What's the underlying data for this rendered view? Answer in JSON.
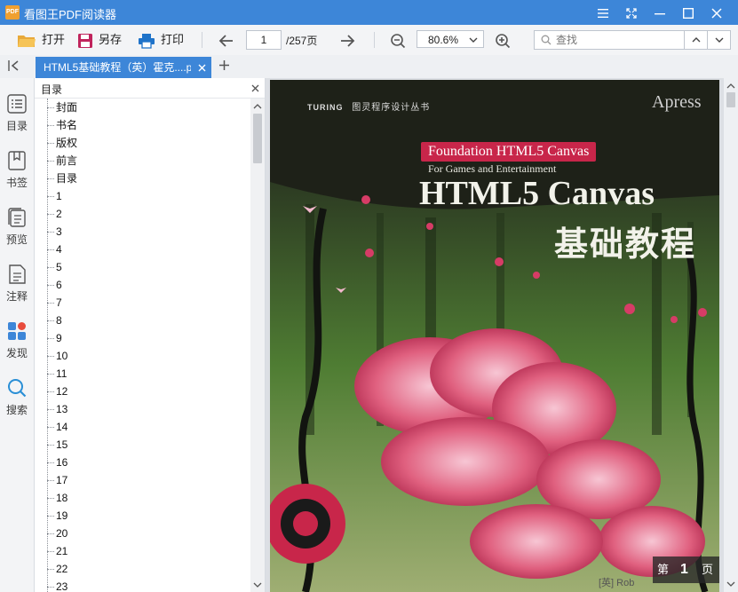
{
  "app": {
    "logo_text": "PDF",
    "title": "看图王PDF阅读器"
  },
  "toolbar": {
    "open_label": "打开",
    "save_as_label": "另存",
    "print_label": "打印",
    "current_page": "1",
    "total_pages": "/257页",
    "zoom_value": "80.6%",
    "search_placeholder": "查找"
  },
  "tabs": [
    {
      "label": "HTML5基础教程（英）霍克....p",
      "active": true
    }
  ],
  "left_rail": [
    {
      "label": "目录",
      "icon": "outline-icon"
    },
    {
      "label": "书签",
      "icon": "bookmark-icon"
    },
    {
      "label": "预览",
      "icon": "preview-icon"
    },
    {
      "label": "注释",
      "icon": "annotation-icon"
    },
    {
      "label": "发现",
      "icon": "discover-icon"
    },
    {
      "label": "搜索",
      "icon": "search-icon"
    }
  ],
  "outline": {
    "title": "目录",
    "items": [
      "封面",
      "书名",
      "版权",
      "前言",
      "目录",
      "1",
      "2",
      "3",
      "4",
      "5",
      "6",
      "7",
      "8",
      "9",
      "10",
      "11",
      "12",
      "13",
      "14",
      "15",
      "16",
      "17",
      "18",
      "19",
      "20",
      "21",
      "22",
      "23"
    ]
  },
  "cover": {
    "series_brand": "TURING",
    "series_name": "图灵程序设计丛书",
    "publisher": "Apress",
    "english_title": "Foundation HTML5 Canvas",
    "english_subtitle": "For Games and Entertainment",
    "main_title": "HTML5 Canvas",
    "main_title_cn": "基础教程",
    "author_fragment": "[英] Rob"
  },
  "page_badge": {
    "prefix": "第",
    "number": "1",
    "suffix": "页"
  },
  "colors": {
    "titlebar": "#3d86d8",
    "accent_icon": "#1f73c9",
    "cover_red": "#c8264a",
    "cover_green": "#5c8f3a"
  }
}
